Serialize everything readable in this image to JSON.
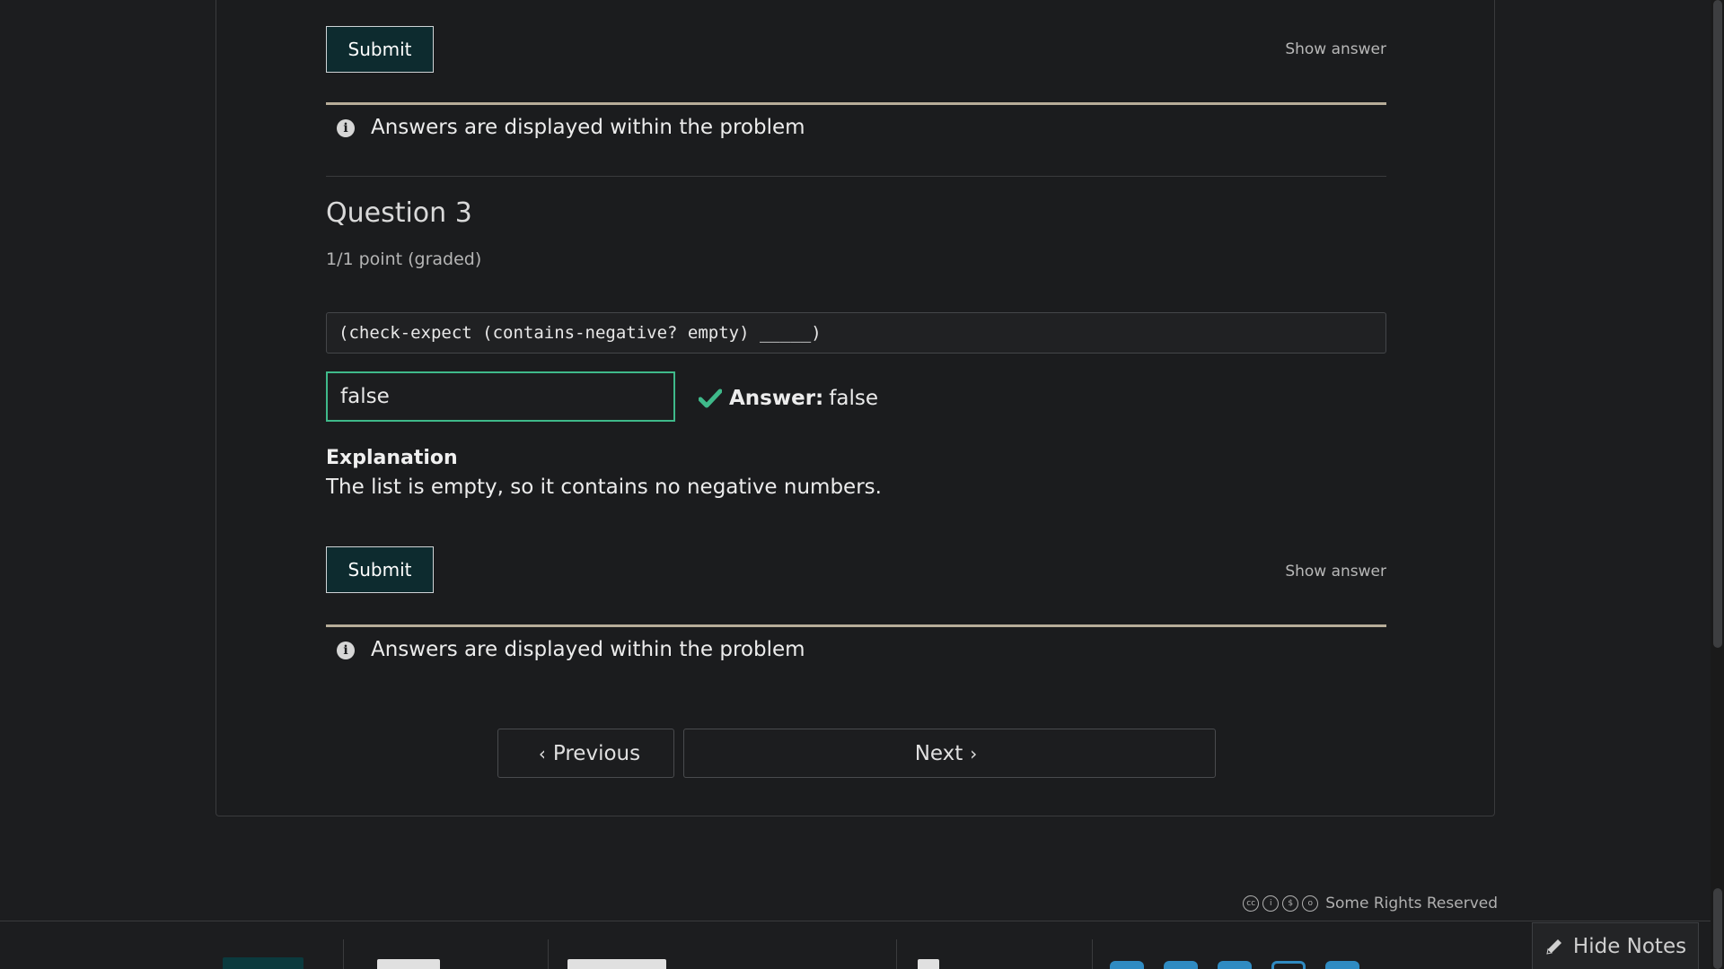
{
  "problem_top": {
    "submit_label": "Submit",
    "show_answer_label": "Show answer",
    "notification": "Answers are displayed within the problem"
  },
  "question3": {
    "title": "Question 3",
    "points": "1/1 point (graded)",
    "code": "(check-expect (contains-negative? empty) _____)",
    "input_value": "false",
    "answer_label": "Answer:",
    "answer_value": "false",
    "explanation_title": "Explanation",
    "explanation_text": "The list is empty, so it contains no negative numbers.",
    "submit_label": "Submit",
    "show_answer_label": "Show answer",
    "notification": "Answers are displayed within the problem"
  },
  "navigation": {
    "previous_label": "Previous",
    "next_label": "Next"
  },
  "footer": {
    "rights_text": "Some Rights Reserved"
  },
  "notes": {
    "hide_notes_label": "Hide Notes"
  },
  "colors": {
    "background": "#1c1d1f",
    "accent_green": "#3fb98a",
    "submit_bg": "#0d2b2f",
    "notification_border": "#b7ad99",
    "social_blue": "#2f8bc2"
  }
}
